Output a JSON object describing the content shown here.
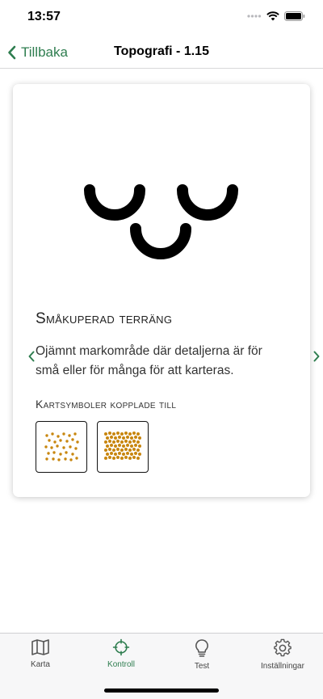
{
  "status_bar": {
    "time": "13:57"
  },
  "nav": {
    "back_label": "Tillbaka",
    "title": "Topografi - 1.15"
  },
  "card": {
    "title": "Småkuperad terräng",
    "description": "Ojämnt markområde där detaljerna är för små eller för många för att karteras.",
    "related_heading": "Kartsymboler kopplade till",
    "related_symbols": [
      {
        "name": "sparse-dots-symbol",
        "color": "#c8860f"
      },
      {
        "name": "dense-dots-symbol",
        "color": "#c8860f"
      }
    ]
  },
  "tabs": [
    {
      "label": "Karta",
      "icon": "map-icon",
      "active": false
    },
    {
      "label": "Kontroll",
      "icon": "crosshair-icon",
      "active": true
    },
    {
      "label": "Test",
      "icon": "lightbulb-icon",
      "active": false
    },
    {
      "label": "Inställningar",
      "icon": "gear-icon",
      "active": false
    }
  ],
  "colors": {
    "accent": "#2e7d4f",
    "symbol_brown": "#c8860f",
    "symbol_black": "#000000"
  }
}
